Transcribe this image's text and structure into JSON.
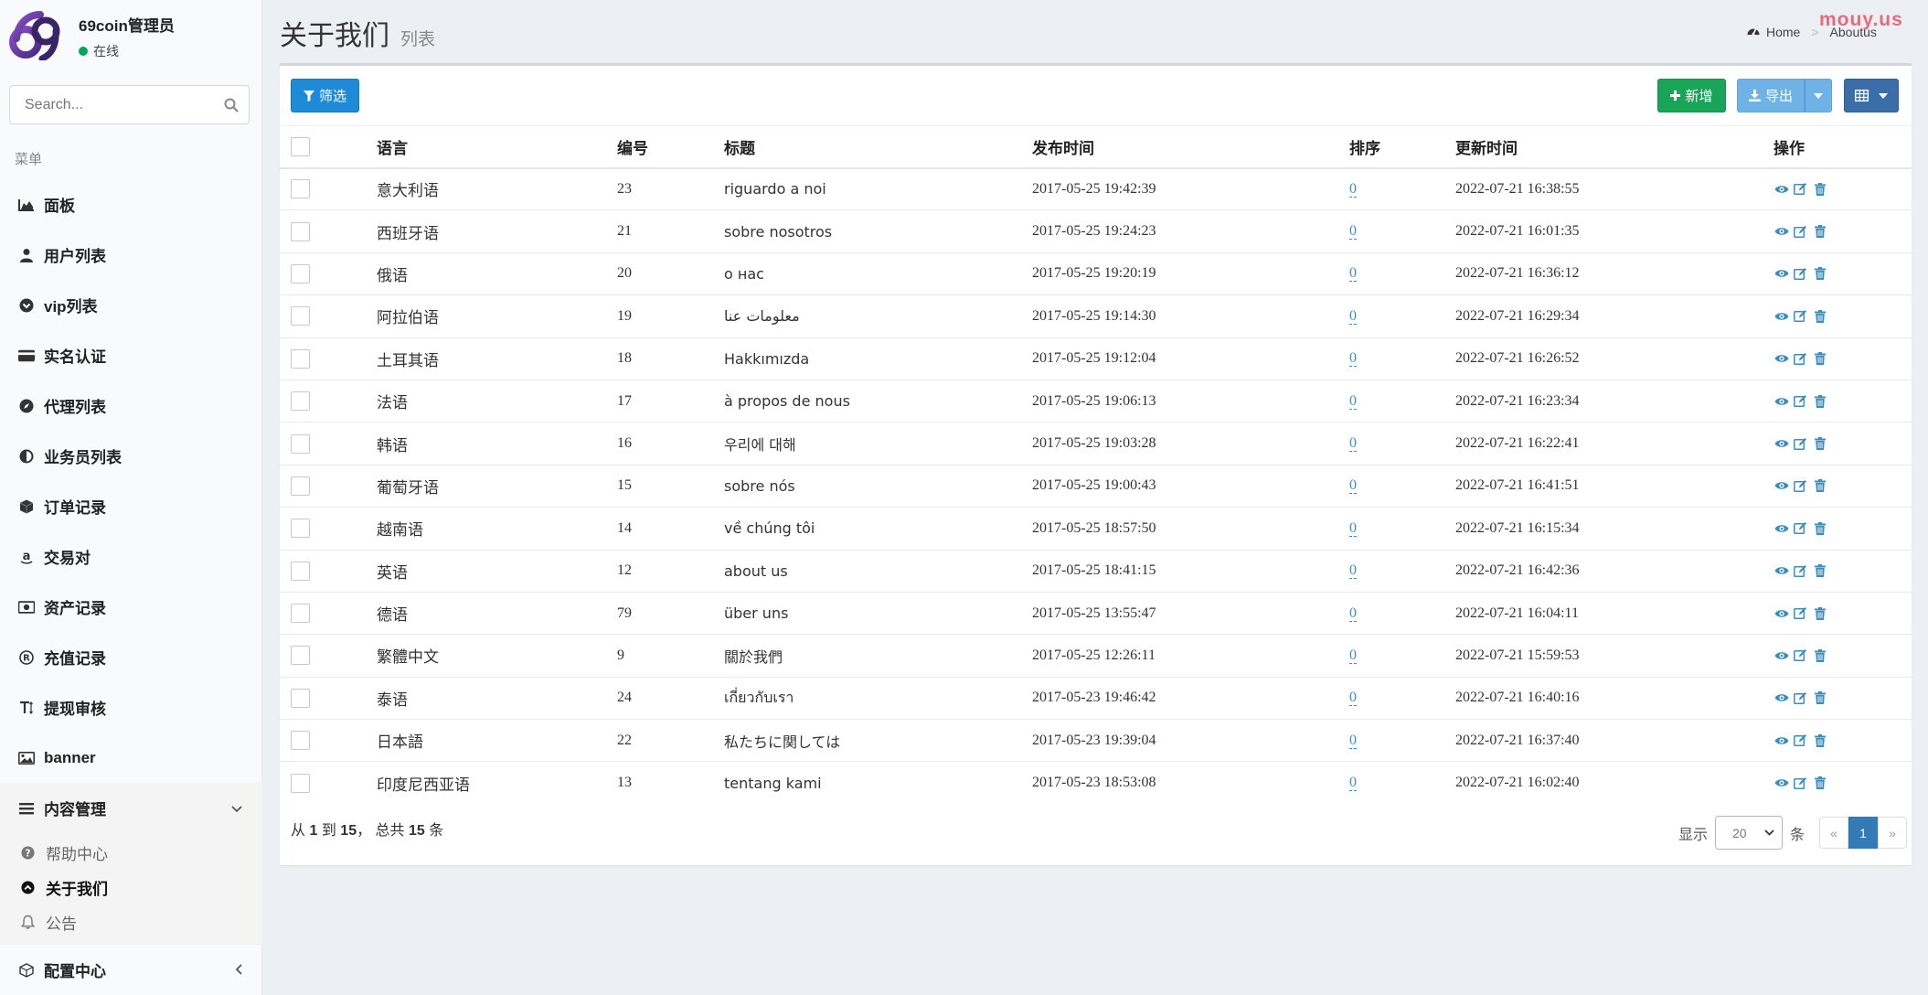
{
  "watermark": "mouy.us",
  "user": {
    "name": "69coin管理员",
    "status": "在线"
  },
  "search": {
    "placeholder": "Search..."
  },
  "menu_header": "菜单",
  "menu": [
    {
      "label": "面板",
      "icon": "area-chart-icon"
    },
    {
      "label": "用户列表",
      "icon": "user-icon"
    },
    {
      "label": "vip列表",
      "icon": "chevron-circle-down-icon"
    },
    {
      "label": "实名认证",
      "icon": "credit-card-icon"
    },
    {
      "label": "代理列表",
      "icon": "compass-icon"
    },
    {
      "label": "业务员列表",
      "icon": "adjust-icon"
    },
    {
      "label": "订单记录",
      "icon": "cube-icon"
    },
    {
      "label": "交易对",
      "icon": "amazon-icon"
    },
    {
      "label": "资产记录",
      "icon": "money-icon"
    },
    {
      "label": "充值记录",
      "icon": "registered-icon"
    },
    {
      "label": "提现审核",
      "icon": "text-height-icon"
    },
    {
      "label": "banner",
      "icon": "image-icon"
    }
  ],
  "content_menu": {
    "label": "内容管理",
    "icon": "list-icon",
    "items": [
      {
        "label": "帮助中心",
        "icon": "question-circle-icon"
      },
      {
        "label": "关于我们",
        "icon": "chevron-circle-up-icon"
      },
      {
        "label": "公告",
        "icon": "bell-icon"
      }
    ]
  },
  "config_menu": {
    "label": "配置中心",
    "icon": "cubes-icon"
  },
  "header": {
    "title": "关于我们",
    "subtitle": "列表"
  },
  "breadcrumb": {
    "home": "Home",
    "current": "Aboutus"
  },
  "toolbar": {
    "filter": "筛选",
    "add": "新增",
    "export": "导出"
  },
  "table": {
    "columns": [
      "语言",
      "编号",
      "标题",
      "发布时间",
      "排序",
      "更新时间",
      "操作"
    ],
    "rows": [
      {
        "lang": "意大利语",
        "id": "23",
        "title": "riguardo a noi",
        "published": "2017-05-25 19:42:39",
        "sort": "0",
        "updated": "2022-07-21 16:38:55"
      },
      {
        "lang": "西班牙语",
        "id": "21",
        "title": "sobre nosotros",
        "published": "2017-05-25 19:24:23",
        "sort": "0",
        "updated": "2022-07-21 16:01:35"
      },
      {
        "lang": "俄语",
        "id": "20",
        "title": "о нас",
        "published": "2017-05-25 19:20:19",
        "sort": "0",
        "updated": "2022-07-21 16:36:12"
      },
      {
        "lang": "阿拉伯语",
        "id": "19",
        "title": "معلومات عنا",
        "published": "2017-05-25 19:14:30",
        "sort": "0",
        "updated": "2022-07-21 16:29:34"
      },
      {
        "lang": "土耳其语",
        "id": "18",
        "title": "Hakkımızda",
        "published": "2017-05-25 19:12:04",
        "sort": "0",
        "updated": "2022-07-21 16:26:52"
      },
      {
        "lang": "法语",
        "id": "17",
        "title": "à propos de nous",
        "published": "2017-05-25 19:06:13",
        "sort": "0",
        "updated": "2022-07-21 16:23:34"
      },
      {
        "lang": "韩语",
        "id": "16",
        "title": "우리에 대해",
        "published": "2017-05-25 19:03:28",
        "sort": "0",
        "updated": "2022-07-21 16:22:41"
      },
      {
        "lang": "葡萄牙语",
        "id": "15",
        "title": "sobre nós",
        "published": "2017-05-25 19:00:43",
        "sort": "0",
        "updated": "2022-07-21 16:41:51"
      },
      {
        "lang": "越南语",
        "id": "14",
        "title": "về chúng tôi",
        "published": "2017-05-25 18:57:50",
        "sort": "0",
        "updated": "2022-07-21 16:15:34"
      },
      {
        "lang": "英语",
        "id": "12",
        "title": "about us",
        "published": "2017-05-25 18:41:15",
        "sort": "0",
        "updated": "2022-07-21 16:42:36"
      },
      {
        "lang": "德语",
        "id": "79",
        "title": "über uns",
        "published": "2017-05-25 13:55:47",
        "sort": "0",
        "updated": "2022-07-21 16:04:11"
      },
      {
        "lang": "繁體中文",
        "id": "9",
        "title": "關於我們",
        "published": "2017-05-25 12:26:11",
        "sort": "0",
        "updated": "2022-07-21 15:59:53"
      },
      {
        "lang": "泰语",
        "id": "24",
        "title": "เกี่ยวกับเรา",
        "published": "2017-05-23 19:46:42",
        "sort": "0",
        "updated": "2022-07-21 16:40:16"
      },
      {
        "lang": "日本語",
        "id": "22",
        "title": "私たちに関しては",
        "published": "2017-05-23 19:39:04",
        "sort": "0",
        "updated": "2022-07-21 16:37:40"
      },
      {
        "lang": "印度尼西亚语",
        "id": "13",
        "title": "tentang kami",
        "published": "2017-05-23 18:53:08",
        "sort": "0",
        "updated": "2022-07-21 16:02:40"
      }
    ]
  },
  "pager": {
    "prefix": "从",
    "from": "1",
    "to_label": "到",
    "to": "15",
    "total_label": "， 总共",
    "total": "15",
    "suffix": "条",
    "show_label": "显示",
    "page_size": "20",
    "unit": "条",
    "prev": "«",
    "current_page": "1",
    "next": "»"
  },
  "colors": {
    "primary": "#1f8ad7",
    "success": "#18a558",
    "info": "#6fb3e6",
    "link": "#3c8dbc",
    "status_online": "#00a65a",
    "watermark": "#e8697a"
  }
}
